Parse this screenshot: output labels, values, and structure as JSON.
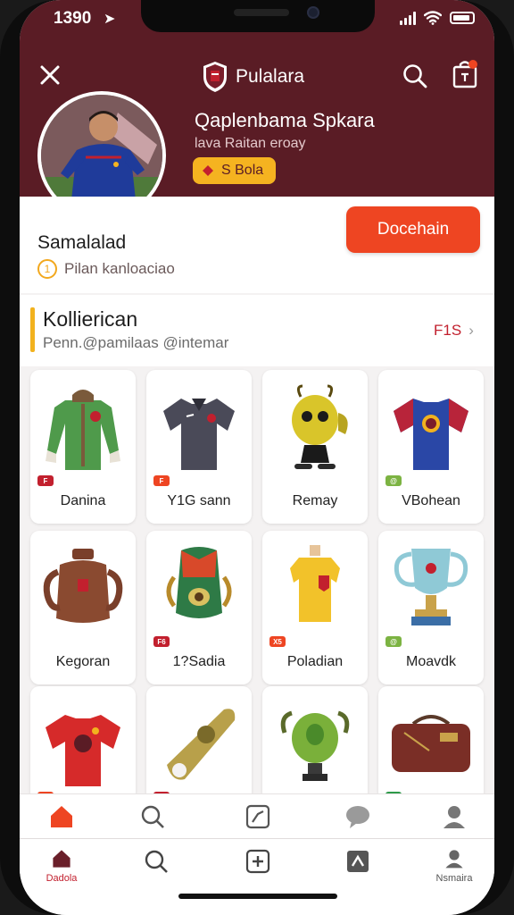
{
  "status": {
    "time": "1390"
  },
  "header": {
    "title": "Pulalara"
  },
  "profile": {
    "name": "Qaplenbama Spkara",
    "subtitle": "lava Raitan eroay",
    "badge": "S Bola"
  },
  "user": {
    "name": "Samalalad",
    "meta": "Pilan kanloaciao",
    "coin_symbol": "1",
    "action_button": "Docehain"
  },
  "section": {
    "title": "Kollierican",
    "subtitle": "Penn.@pamilaas @intemar",
    "see_all": "F1S"
  },
  "collection": [
    {
      "label": "Danina",
      "tag": "F",
      "tag_color": "#c2202e",
      "icon": "green-jacket"
    },
    {
      "label": "Y1G sann",
      "tag": "F",
      "tag_color": "#ee4522",
      "icon": "grey-polo"
    },
    {
      "label": "Remay",
      "tag": "",
      "tag_color": "",
      "icon": "yellow-mascot"
    },
    {
      "label": "VBohean",
      "tag": "@",
      "tag_color": "#7cb342",
      "icon": "blue-jersey"
    },
    {
      "label": "Kegoran",
      "tag": "",
      "tag_color": "",
      "icon": "clay-jug"
    },
    {
      "label": "1?Sadia",
      "tag": "F6",
      "tag_color": "#c2202e",
      "icon": "green-sculpture"
    },
    {
      "label": "Poladian",
      "tag": "X5",
      "tag_color": "#ee4522",
      "icon": "yellow-jersey"
    },
    {
      "label": "Moavdk",
      "tag": "@",
      "tag_color": "#7cb342",
      "icon": "silver-trophy"
    },
    {
      "label": "",
      "tag": "F",
      "tag_color": "#ee4522",
      "icon": "red-jersey"
    },
    {
      "label": "",
      "tag": "F",
      "tag_color": "#c2202e",
      "icon": "brass-horn"
    },
    {
      "label": "",
      "tag": "",
      "tag_color": "",
      "icon": "green-trophy"
    },
    {
      "label": "",
      "tag": "@",
      "tag_color": "#2e9a4a",
      "icon": "leather-bag"
    }
  ],
  "tabs": [
    {
      "label": "Dadola",
      "icon": "home-icon"
    },
    {
      "label": "",
      "icon": "search-icon"
    },
    {
      "label": "",
      "icon": "add-icon"
    },
    {
      "label": "",
      "icon": "gallery-icon"
    },
    {
      "label": "Nsmaira",
      "icon": "profile-icon"
    }
  ],
  "colors": {
    "hero": "#5a1c25",
    "accent": "#ee4522",
    "badge": "#f5b320",
    "section_bar": "#f2b21e"
  }
}
